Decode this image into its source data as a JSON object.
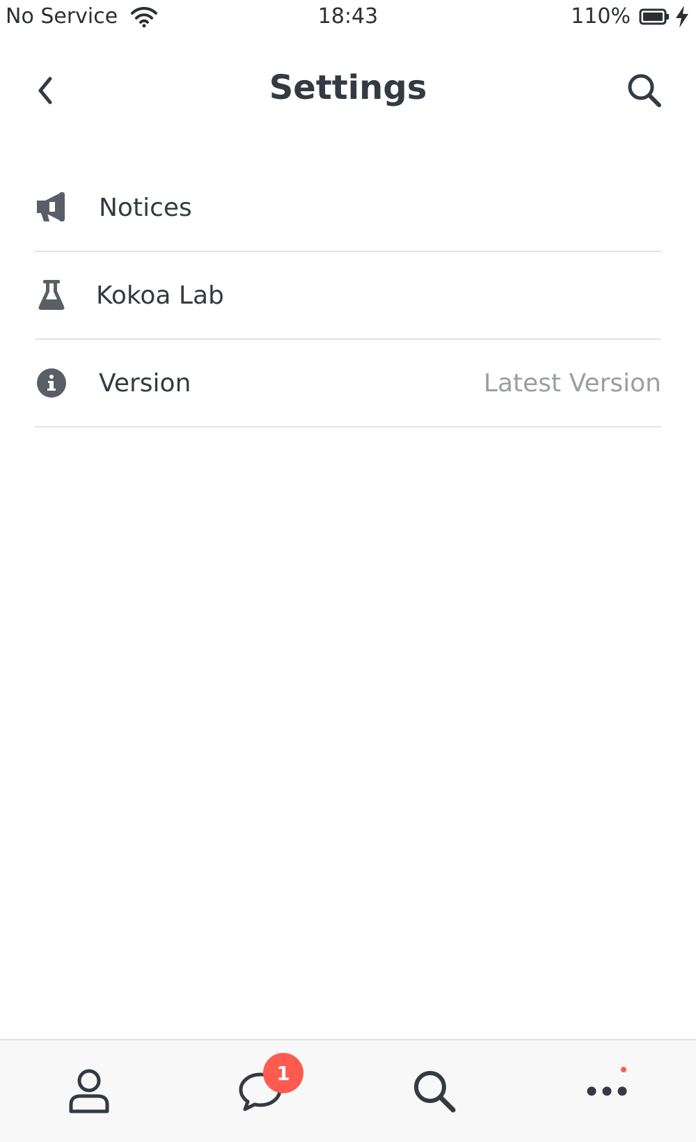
{
  "status_bar": {
    "carrier": "No Service",
    "time": "18:43",
    "battery": "110%"
  },
  "header": {
    "title": "Settings"
  },
  "settings": {
    "items": [
      {
        "label": "Notices",
        "icon": "megaphone-icon",
        "value": ""
      },
      {
        "label": "Kokoa Lab",
        "icon": "flask-icon",
        "value": ""
      },
      {
        "label": "Version",
        "icon": "info-icon",
        "value": "Latest Version"
      }
    ]
  },
  "tab_bar": {
    "tabs": [
      {
        "name": "friends",
        "icon": "person-icon"
      },
      {
        "name": "chats",
        "icon": "chat-bubble-icon",
        "badge": "1"
      },
      {
        "name": "search",
        "icon": "search-icon"
      },
      {
        "name": "more",
        "icon": "more-dots-icon",
        "has_dot": true
      }
    ]
  },
  "colors": {
    "text": "#333a42",
    "secondary_text": "#9a9ea3",
    "badge": "#ff5a4e",
    "divider": "#e3e3e3",
    "tab_bar_bg": "#f8f8f8"
  }
}
